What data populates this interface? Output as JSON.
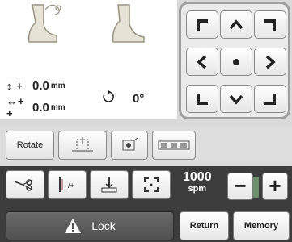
{
  "info": {
    "x_symbol": "↕ +",
    "x_value": "0.0",
    "y_symbol": "↔+ +",
    "y_value": "0.0",
    "unit": "mm",
    "rotation": "0°"
  },
  "move_panel": {
    "buttons": [
      "arrow-up-left-icon",
      "arrow-up-icon",
      "arrow-up-right-icon",
      "arrow-left-icon",
      "center-icon",
      "arrow-right-icon",
      "arrow-down-left-icon",
      "arrow-down-icon",
      "arrow-down-right-icon"
    ]
  },
  "toolbar1": {
    "rotate_label": "Rotate"
  },
  "toolbar2": {
    "speed_value": "1000",
    "speed_unit": "spm",
    "minus_label": "−",
    "plus_label": "+",
    "lock_label": "Lock",
    "return_label": "Return",
    "memory_label": "Memory"
  },
  "colors": {
    "panel_bg": "#3c3c3c",
    "accent_border": "#9e9e9e"
  }
}
